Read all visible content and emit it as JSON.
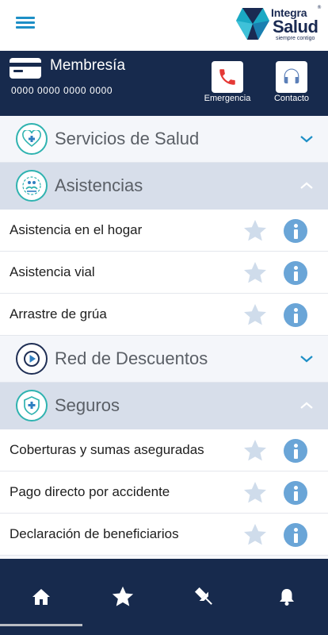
{
  "header": {
    "menu_icon": "hamburger-menu-icon",
    "logo": {
      "line1": "Integra",
      "line2": "Salud",
      "tagline": "siempre contigo",
      "registered": "®"
    }
  },
  "membership": {
    "title": "Membresía",
    "number": "0000 0000  0000  0000",
    "card_icon": "credit-card-icon",
    "actions": [
      {
        "label": "Emergencia",
        "icon": "phone-icon",
        "color": "#e53935"
      },
      {
        "label": "Contacto",
        "icon": "headset-icon",
        "color": "#5b7fb8"
      }
    ]
  },
  "sections": {
    "servicios": {
      "title": "Servicios de Salud",
      "icon": "heart-plus-icon",
      "expanded": false
    },
    "asistencias": {
      "title": "Asistencias",
      "icon": "hands-people-icon",
      "expanded": true,
      "items": [
        {
          "label": "Asistencia en el hogar"
        },
        {
          "label": "Asistencia vial"
        },
        {
          "label": "Arrastre de grúa"
        }
      ]
    },
    "descuentos": {
      "title": "Red de Descuentos",
      "icon": "play-circle-icon",
      "expanded": false
    },
    "seguros": {
      "title": "Seguros",
      "icon": "shield-plus-icon",
      "expanded": true,
      "items": [
        {
          "label": "Coberturas y sumas aseguradas"
        },
        {
          "label": "Pago directo por accidente"
        },
        {
          "label": "Declaración de beneficiarios"
        }
      ]
    }
  },
  "bottom_nav": [
    {
      "icon": "home-icon"
    },
    {
      "icon": "star-icon"
    },
    {
      "icon": "pin-icon"
    },
    {
      "icon": "bell-icon"
    }
  ],
  "colors": {
    "navy": "#172a4d",
    "teal": "#2fb3b0",
    "accent_blue": "#1d8fc6",
    "info_blue": "#6aa5d7",
    "star_gray": "#cfdceb"
  }
}
